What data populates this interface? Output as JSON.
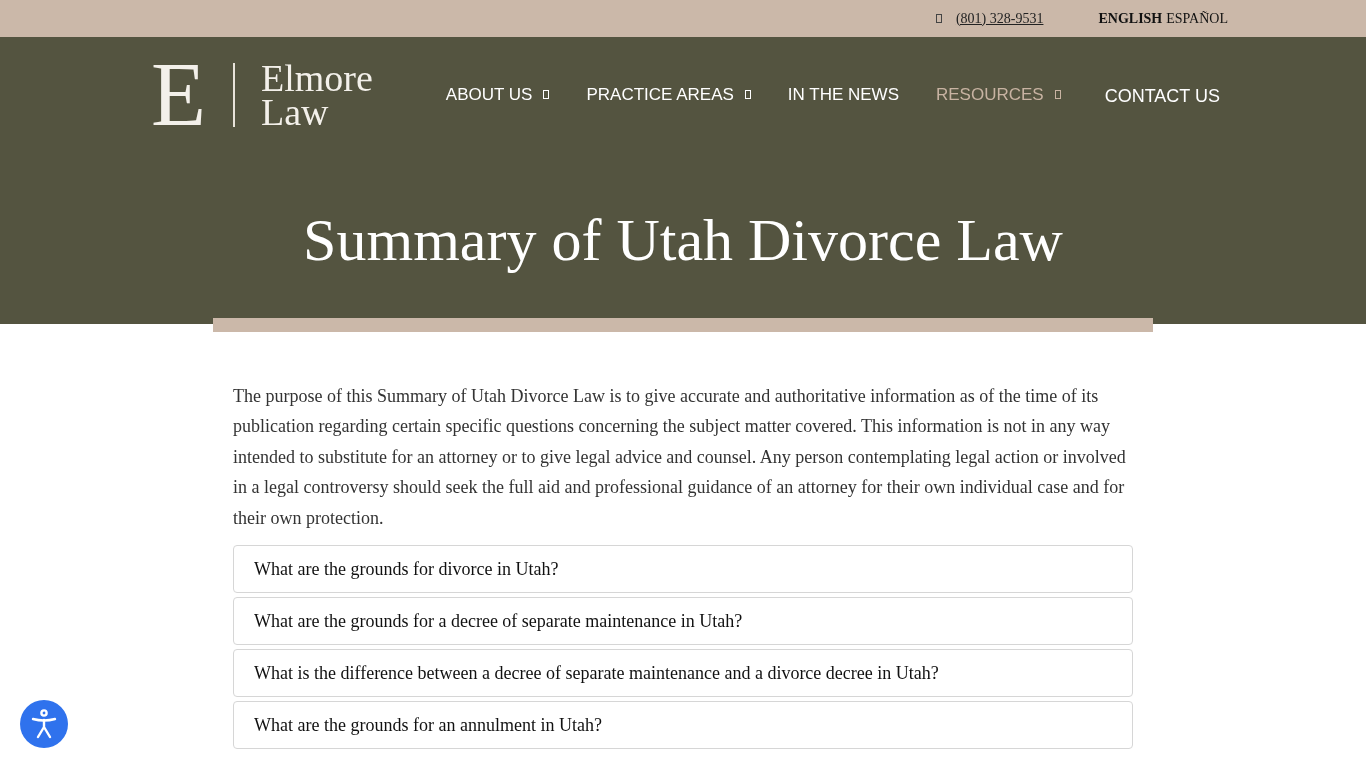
{
  "top_bar": {
    "phone": "(801) 328-9531",
    "languages": [
      {
        "label": "ENGLISH",
        "selected": true
      },
      {
        "label": "ESPAÑOL",
        "selected": false
      }
    ]
  },
  "logo": {
    "monogram": "E",
    "name_lines": [
      "Elmore",
      "Law"
    ]
  },
  "nav": [
    {
      "label": "ABOUT US",
      "kind": "dropdown",
      "selected": false
    },
    {
      "label": "PRACTICE AREAS",
      "kind": "dropdown",
      "selected": false
    },
    {
      "label": "IN THE NEWS",
      "kind": "link",
      "selected": false
    },
    {
      "label": "RESOURCES",
      "kind": "dropdown",
      "selected": true
    },
    {
      "label": "CONTACT US",
      "kind": "cta",
      "selected": false
    }
  ],
  "page_title": "Summary of Utah Divorce Law",
  "intro": "The purpose of this Summary of Utah Divorce Law is to give accurate and authoritative information as of the time of its publication regarding certain specific questions concerning the subject matter covered. This information is not in any way intended to substitute for an attorney or to give legal advice and counsel. Any person contemplating legal action or involved in a legal controversy should seek the full aid and professional guidance of an attorney for their own individual case and for their own protection.",
  "faq": [
    {
      "question": "What are the grounds for divorce in Utah?",
      "expanded": false
    },
    {
      "question": "What are the grounds for a decree of separate maintenance in Utah?",
      "expanded": false
    },
    {
      "question": "What is the difference between a decree of separate maintenance and a divorce decree in Utah?",
      "expanded": false
    },
    {
      "question": "What are the grounds for an annulment in Utah?",
      "expanded": false
    }
  ]
}
